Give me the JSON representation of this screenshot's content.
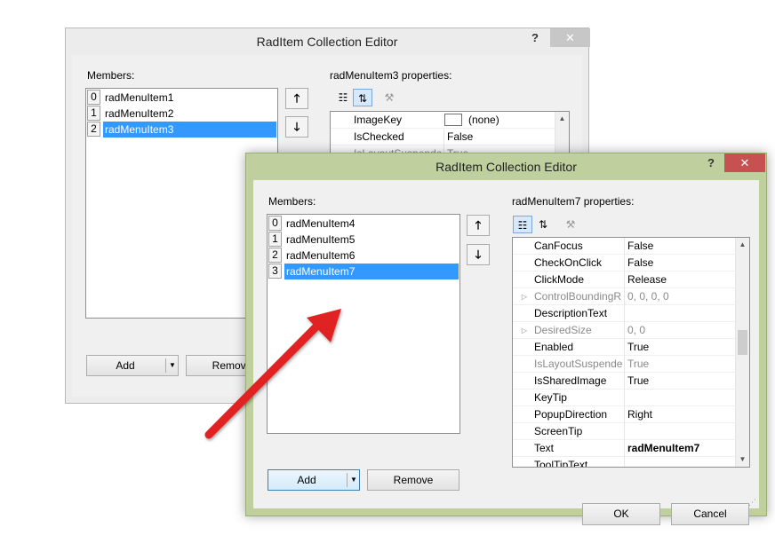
{
  "background_dialog": {
    "title": "RadItem Collection Editor",
    "help_glyph": "?",
    "close_glyph": "✕",
    "members_label": "Members:",
    "members": [
      {
        "index": "0",
        "name": "radMenuItem1"
      },
      {
        "index": "1",
        "name": "radMenuItem2"
      },
      {
        "index": "2",
        "name": "radMenuItem3",
        "selected": true
      }
    ],
    "move_up_glyph": "🡑",
    "move_down_glyph": "🡓",
    "properties_label": "radMenuItem3 properties:",
    "properties": [
      {
        "name": "ImageKey",
        "value": "(none)"
      },
      {
        "name": "IsChecked",
        "value": "False"
      },
      {
        "name": "IsLayoutSuspendec",
        "value": "True"
      }
    ],
    "add_label": "Add",
    "remove_label": "Remove"
  },
  "front_dialog": {
    "title": "RadItem Collection Editor",
    "help_glyph": "?",
    "close_glyph": "✕",
    "members_label": "Members:",
    "members": [
      {
        "index": "0",
        "name": "radMenuItem4"
      },
      {
        "index": "1",
        "name": "radMenuItem5"
      },
      {
        "index": "2",
        "name": "radMenuItem6"
      },
      {
        "index": "3",
        "name": "radMenuItem7",
        "selected": true
      }
    ],
    "move_up_glyph": "🡑",
    "move_down_glyph": "🡓",
    "properties_label": "radMenuItem7 properties:",
    "properties": [
      {
        "name": "CanFocus",
        "value": "False"
      },
      {
        "name": "CheckOnClick",
        "value": "False"
      },
      {
        "name": "ClickMode",
        "value": "Release"
      },
      {
        "name": "ControlBoundingR",
        "value": "0, 0, 0, 0",
        "expandable": true,
        "grayed": true
      },
      {
        "name": "DescriptionText",
        "value": ""
      },
      {
        "name": "DesiredSize",
        "value": "0, 0",
        "expandable": true,
        "grayed": true
      },
      {
        "name": "Enabled",
        "value": "True"
      },
      {
        "name": "IsLayoutSuspendec",
        "value": "True",
        "grayed": true
      },
      {
        "name": "IsSharedImage",
        "value": "True"
      },
      {
        "name": "KeyTip",
        "value": ""
      },
      {
        "name": "PopupDirection",
        "value": "Right"
      },
      {
        "name": "ScreenTip",
        "value": ""
      },
      {
        "name": "Text",
        "value": "radMenuItem7",
        "bold_value": true
      },
      {
        "name": "ToolTipText",
        "value": ""
      }
    ],
    "add_label": "Add",
    "remove_label": "Remove",
    "ok_label": "OK",
    "cancel_label": "Cancel"
  },
  "icons": {
    "categorized": "categorized-icon",
    "alphabetical": "alphabetical-sort-icon",
    "property_pages": "wrench-icon",
    "annotation_arrow": "red-arrow-icon"
  },
  "colors": {
    "selection": "#3399ff",
    "front_frame": "#bfcf9e",
    "close_active": "#c75050",
    "arrow_red": "#e02020"
  }
}
